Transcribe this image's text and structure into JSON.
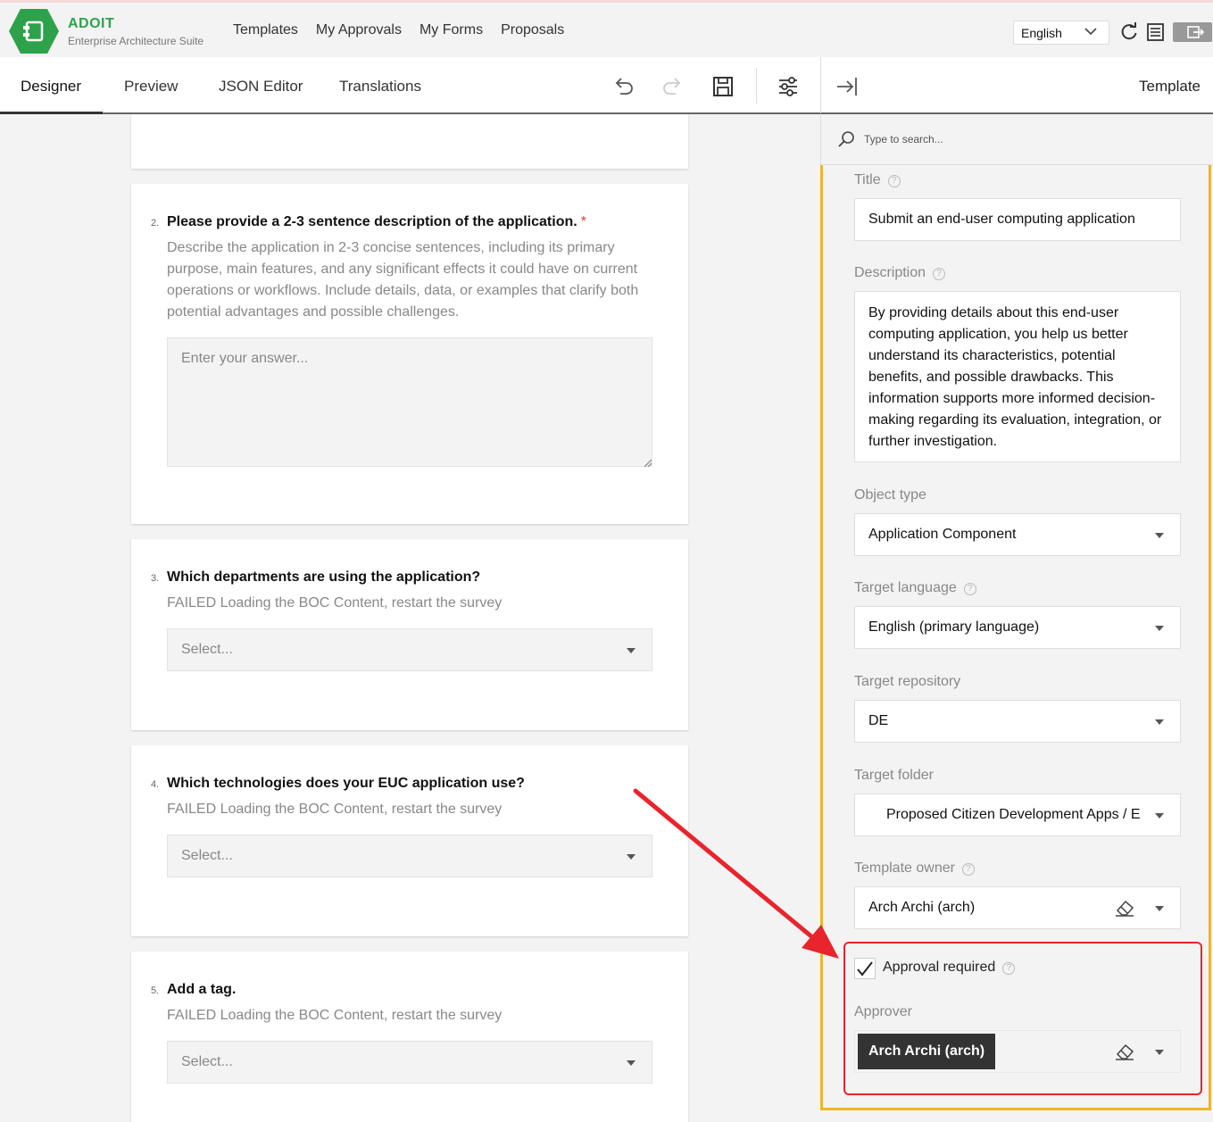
{
  "header": {
    "brand": "ADOIT",
    "brand_sub": "Enterprise Architecture Suite",
    "nav": [
      "Templates",
      "My Approvals",
      "My Forms",
      "Proposals"
    ],
    "language": "English"
  },
  "editor": {
    "tabs": [
      "Designer",
      "Preview",
      "JSON Editor",
      "Translations"
    ],
    "active_tab": "Designer"
  },
  "questions": [
    {
      "num": "2.",
      "title": "Please provide a 2-3 sentence description of the application.",
      "required": "*",
      "description": "Describe the application in 2-3 concise sentences, including its primary purpose, main features, and any significant effects it could have on current operations or workflows. Include details, data, or examples that clarify both potential advantages and possible challenges.",
      "placeholder": "Enter your answer..."
    },
    {
      "num": "3.",
      "title": "Which departments are using the application?",
      "description": "FAILED Loading the BOC Content, restart the survey",
      "placeholder": "Select..."
    },
    {
      "num": "4.",
      "title": "Which technologies does your EUC application use?",
      "description": "FAILED Loading the BOC Content, restart the survey",
      "placeholder": "Select..."
    },
    {
      "num": "5.",
      "title": "Add a tag.",
      "description": "FAILED Loading the BOC Content, restart the survey",
      "placeholder": "Select..."
    }
  ],
  "panel": {
    "title": "Template",
    "search_placeholder": "Type to search...",
    "fields": {
      "title_label": "Title",
      "title_value": "Submit an end-user computing application",
      "description_label": "Description",
      "description_value": "By providing details about this end-user computing application, you help us better understand its characteristics, potential benefits, and possible drawbacks. This information supports more informed decision-making regarding its evaluation, integration, or further investigation.",
      "object_type_label": "Object type",
      "object_type_value": "Application Component",
      "target_language_label": "Target language",
      "target_language_value": "English (primary language)",
      "target_repository_label": "Target repository",
      "target_repository_value": "DE",
      "target_folder_label": "Target folder",
      "target_folder_value": "Proposed Citizen Development Apps / E",
      "template_owner_label": "Template owner",
      "template_owner_value": "Arch Archi (arch)",
      "approval_required_label": "Approval required",
      "approval_required": true,
      "approver_label": "Approver",
      "approver_value": "Arch Archi (arch)"
    }
  },
  "colors": {
    "brand_green": "#2ea24a",
    "panel_border": "#f0b429",
    "highlight_red": "#e8242c",
    "required_red": "#e53935"
  }
}
